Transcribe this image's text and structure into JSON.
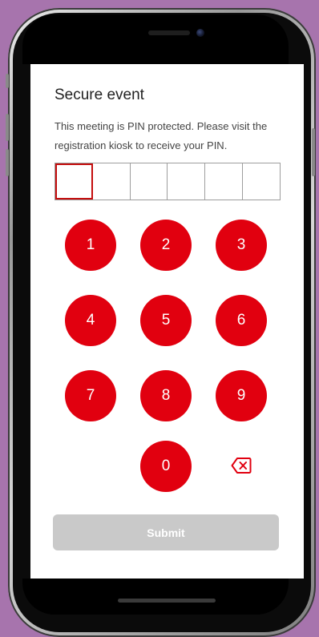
{
  "page": {
    "title": "Secure event",
    "description": "This meeting is PIN protected. Please visit the registration kiosk to receive your PIN."
  },
  "pin": {
    "length": 6,
    "digits": [
      "",
      "",
      "",
      "",
      "",
      ""
    ],
    "active_index": 0
  },
  "keypad": {
    "keys": [
      "1",
      "2",
      "3",
      "4",
      "5",
      "6",
      "7",
      "8",
      "9",
      "0"
    ],
    "backspace_icon": "backspace-icon"
  },
  "actions": {
    "submit_label": "Submit",
    "submit_enabled": false
  },
  "theme": {
    "accent": "#e1000f",
    "disabled": "#c9c9c9",
    "background": "#a774ad"
  }
}
